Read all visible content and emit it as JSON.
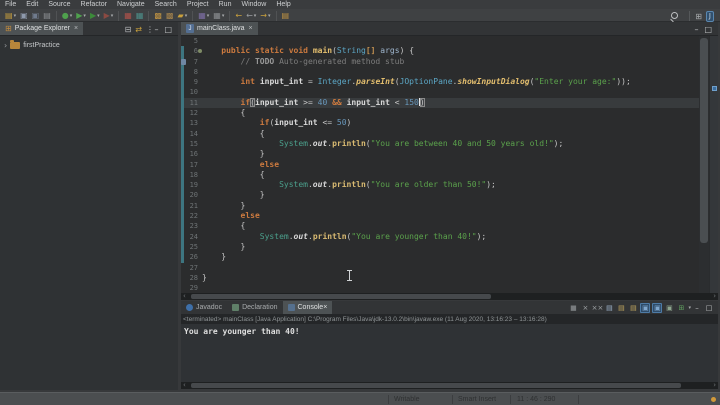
{
  "menu": {
    "items": [
      "File",
      "Edit",
      "Source",
      "Refactor",
      "Navigate",
      "Search",
      "Project",
      "Run",
      "Window",
      "Help"
    ]
  },
  "glyphs": {
    "close": "×",
    "dropdown": "▾",
    "chevron": "›",
    "minimize": "–",
    "maximize": "□",
    "collapse_all": "⊟",
    "link_editor": "⇄",
    "view_menu": "⋮",
    "scroll_left": "‹",
    "scroll_right": "›"
  },
  "toolbar": {
    "items": [
      {
        "name": "new-wizard-icon",
        "ch": "▤",
        "fg": "#C9A03C",
        "dd": true
      },
      {
        "name": "save-icon",
        "ch": "▣",
        "fg": "#8E99AC"
      },
      {
        "name": "save-all-icon",
        "ch": "▣",
        "fg": "#6F7A8C"
      },
      {
        "name": "print-icon",
        "ch": "▤",
        "fg": "#8A8D90"
      },
      {
        "sep": true
      },
      {
        "name": "debug-icon",
        "ch": "●",
        "fg": "#4FA14D",
        "dd": true
      },
      {
        "name": "run-icon",
        "ch": "▶",
        "fg": "#4FA14D",
        "dd": true
      },
      {
        "name": "run-external-icon",
        "ch": "▶",
        "fg": "#3C8B3A",
        "dd": true
      },
      {
        "name": "coverage-icon",
        "ch": "▶",
        "fg": "#8B4A42",
        "dd": true
      },
      {
        "sep": true
      },
      {
        "name": "stop-icon",
        "ch": "▦",
        "fg": "#B0524A"
      },
      {
        "name": "build-icon",
        "ch": "▦",
        "fg": "#4D8F8A"
      },
      {
        "sep": true
      },
      {
        "name": "new-java-project-icon",
        "ch": "▩",
        "fg": "#BD9142"
      },
      {
        "name": "new-package-icon",
        "ch": "▩",
        "fg": "#A5834C"
      },
      {
        "name": "new-class-icon",
        "ch": "▰",
        "fg": "#C9A03C",
        "dd": true
      },
      {
        "sep": true
      },
      {
        "name": "task-icon",
        "ch": "▦",
        "fg": "#7E6FA5",
        "dd": true
      },
      {
        "name": "annotation-icon",
        "ch": "▦",
        "fg": "#8A8D90",
        "dd": true
      },
      {
        "sep": true
      },
      {
        "name": "back-icon",
        "ch": "←",
        "fg": "#C9A03C"
      },
      {
        "name": "back-history-icon",
        "ch": "←",
        "fg": "#9A9DA0",
        "dd": true
      },
      {
        "name": "forward-icon",
        "ch": "→",
        "fg": "#C9A03C",
        "dd": true
      },
      {
        "sep": true
      },
      {
        "name": "last-edit-icon",
        "ch": "▤",
        "fg": "#BD9142"
      }
    ]
  },
  "package_explorer": {
    "tab_label": "Package Explorer",
    "project": "firstPractice",
    "tools": [
      {
        "name": "collapse-all-icon",
        "glyph": "⊟",
        "color": "#B9BCBE"
      },
      {
        "name": "link-editor-icon",
        "glyph": "⇄",
        "color": "#C9A03C"
      },
      {
        "name": "view-menu-icon",
        "glyph": "⋮",
        "color": "#B9BCBE"
      }
    ]
  },
  "editor": {
    "tab_label": "mainClass.java",
    "file_icon_letter": "J",
    "active_line": 11,
    "lines": [
      {
        "n": 5,
        "diff": false,
        "tokens": []
      },
      {
        "n": 6,
        "diff": true,
        "marker": "dot",
        "tokens": [
          [
            "ws",
            "    "
          ],
          [
            "kw",
            "public"
          ],
          [
            "plain",
            " "
          ],
          [
            "kw",
            "static"
          ],
          [
            "plain",
            " "
          ],
          [
            "kw",
            "void"
          ],
          [
            "plain",
            " "
          ],
          [
            "decl",
            "main"
          ],
          [
            "plain",
            "("
          ],
          [
            "type",
            "String"
          ],
          [
            "arr",
            "[]"
          ],
          [
            "plain",
            " "
          ],
          [
            "param",
            "args"
          ],
          [
            "plain",
            ") {"
          ]
        ]
      },
      {
        "n": 7,
        "diff": true,
        "marker": "task",
        "tokens": [
          [
            "ws",
            "        "
          ],
          [
            "cmt",
            "// "
          ],
          [
            "task",
            "TODO"
          ],
          [
            "cmt",
            " Auto-generated method stub"
          ]
        ]
      },
      {
        "n": 8,
        "diff": true,
        "tokens": []
      },
      {
        "n": 9,
        "diff": true,
        "tokens": [
          [
            "ws",
            "        "
          ],
          [
            "kw",
            "int"
          ],
          [
            "plain",
            " "
          ],
          [
            "var",
            "input_int"
          ],
          [
            "plain",
            " = "
          ],
          [
            "type",
            "Integer"
          ],
          [
            "plain",
            "."
          ],
          [
            "smeth",
            "parseInt"
          ],
          [
            "plain",
            "("
          ],
          [
            "type",
            "JOptionPane"
          ],
          [
            "plain",
            "."
          ],
          [
            "smeth",
            "showInputDialog"
          ],
          [
            "plain",
            "("
          ],
          [
            "str",
            "\"Enter your age:\""
          ],
          [
            "plain",
            "));"
          ]
        ]
      },
      {
        "n": 10,
        "diff": true,
        "tokens": []
      },
      {
        "n": 11,
        "diff": true,
        "tokens": [
          [
            "ws",
            "        "
          ],
          [
            "kw",
            "if"
          ],
          [
            "brkt",
            "("
          ],
          [
            "var",
            "input_int"
          ],
          [
            "plain",
            " >= "
          ],
          [
            "num",
            "40"
          ],
          [
            "plain",
            " "
          ],
          [
            "op2",
            "&&"
          ],
          [
            "plain",
            " "
          ],
          [
            "var",
            "input_int"
          ],
          [
            "plain",
            " < "
          ],
          [
            "num",
            "150"
          ],
          [
            "caret",
            ""
          ],
          [
            "brkt",
            ")"
          ]
        ]
      },
      {
        "n": 12,
        "diff": true,
        "tokens": [
          [
            "ws",
            "        "
          ],
          [
            "plain",
            "{"
          ]
        ]
      },
      {
        "n": 13,
        "diff": true,
        "tokens": [
          [
            "ws",
            "            "
          ],
          [
            "kw",
            "if"
          ],
          [
            "plain",
            "("
          ],
          [
            "var",
            "input_int"
          ],
          [
            "plain",
            " <= "
          ],
          [
            "num",
            "50"
          ],
          [
            "plain",
            ")"
          ]
        ]
      },
      {
        "n": 14,
        "diff": true,
        "tokens": [
          [
            "ws",
            "            "
          ],
          [
            "plain",
            "{"
          ]
        ]
      },
      {
        "n": 15,
        "diff": true,
        "tokens": [
          [
            "ws",
            "                "
          ],
          [
            "sys",
            "System"
          ],
          [
            "plain",
            "."
          ],
          [
            "field",
            "out"
          ],
          [
            "plain",
            "."
          ],
          [
            "meth",
            "println"
          ],
          [
            "plain",
            "("
          ],
          [
            "str",
            "\"You are between 40 and 50 years old!\""
          ],
          [
            "plain",
            ");"
          ]
        ]
      },
      {
        "n": 16,
        "diff": true,
        "tokens": [
          [
            "ws",
            "            "
          ],
          [
            "plain",
            "}"
          ]
        ]
      },
      {
        "n": 17,
        "diff": true,
        "tokens": [
          [
            "ws",
            "            "
          ],
          [
            "kw",
            "else"
          ]
        ]
      },
      {
        "n": 18,
        "diff": true,
        "tokens": [
          [
            "ws",
            "            "
          ],
          [
            "plain",
            "{"
          ]
        ]
      },
      {
        "n": 19,
        "diff": true,
        "tokens": [
          [
            "ws",
            "                "
          ],
          [
            "sys",
            "System"
          ],
          [
            "plain",
            "."
          ],
          [
            "field",
            "out"
          ],
          [
            "plain",
            "."
          ],
          [
            "meth",
            "println"
          ],
          [
            "plain",
            "("
          ],
          [
            "str",
            "\"You are older than 50!\""
          ],
          [
            "plain",
            ");"
          ]
        ]
      },
      {
        "n": 20,
        "diff": true,
        "tokens": [
          [
            "ws",
            "            "
          ],
          [
            "plain",
            "}"
          ]
        ]
      },
      {
        "n": 21,
        "diff": true,
        "tokens": [
          [
            "ws",
            "        "
          ],
          [
            "plain",
            "}"
          ]
        ]
      },
      {
        "n": 22,
        "diff": true,
        "tokens": [
          [
            "ws",
            "        "
          ],
          [
            "kw",
            "else"
          ]
        ]
      },
      {
        "n": 23,
        "diff": true,
        "tokens": [
          [
            "ws",
            "        "
          ],
          [
            "plain",
            "{"
          ]
        ]
      },
      {
        "n": 24,
        "diff": true,
        "tokens": [
          [
            "ws",
            "            "
          ],
          [
            "sys",
            "System"
          ],
          [
            "plain",
            "."
          ],
          [
            "field",
            "out"
          ],
          [
            "plain",
            "."
          ],
          [
            "meth",
            "println"
          ],
          [
            "plain",
            "("
          ],
          [
            "str",
            "\"You are younger than 40!\""
          ],
          [
            "plain",
            ");"
          ]
        ]
      },
      {
        "n": 25,
        "diff": true,
        "tokens": [
          [
            "ws",
            "        "
          ],
          [
            "plain",
            "}"
          ]
        ]
      },
      {
        "n": 26,
        "diff": true,
        "tokens": [
          [
            "ws",
            "    "
          ],
          [
            "plain",
            "}"
          ]
        ]
      },
      {
        "n": 27,
        "diff": false,
        "tokens": []
      },
      {
        "n": 28,
        "diff": false,
        "tokens": [
          [
            "plain",
            "}"
          ]
        ]
      },
      {
        "n": 29,
        "diff": false,
        "tokens": []
      }
    ]
  },
  "console": {
    "tabs": [
      {
        "label": "Javadoc"
      },
      {
        "label": "Declaration"
      },
      {
        "label": "Console",
        "active": true
      }
    ],
    "toolbar": [
      {
        "name": "terminate-icon",
        "ch": "■",
        "fg": "#787B7E"
      },
      {
        "name": "remove-launch-icon",
        "ch": "×",
        "fg": "#9FA3A6"
      },
      {
        "name": "remove-all-launches-icon",
        "ch": "××",
        "fg": "#9FA3A6"
      },
      {
        "name": "clear-console-icon",
        "ch": "▤",
        "fg": "#9FB6CE"
      },
      {
        "name": "scroll-lock-icon",
        "ch": "▤",
        "fg": "#C4A95E"
      },
      {
        "name": "word-wrap-icon",
        "ch": "▤",
        "fg": "#C4A95E"
      },
      {
        "name": "pin-console-icon",
        "ch": "▣",
        "fg": "#7FA6CC",
        "hl": true
      },
      {
        "name": "show-stdout-icon",
        "ch": "▣",
        "fg": "#7FA6CC",
        "hl": true
      },
      {
        "name": "show-stderr-icon",
        "ch": "▣",
        "fg": "#8FA68F"
      },
      {
        "name": "open-console-icon",
        "ch": "⊞",
        "fg": "#5FA05F",
        "dd": true
      },
      {
        "name": "minimize-icon",
        "ch": "–",
        "fg": "#C2C5C7"
      },
      {
        "name": "maximize-icon",
        "ch": "□",
        "fg": "#C2C5C7"
      }
    ],
    "status": "<terminated> mainClass [Java Application] C:\\Program Files\\Java\\jdk-13.0.2\\bin\\javaw.exe (11 Aug 2020, 13:16:23 – 13:16:28)",
    "output": "You are younger than 40!"
  },
  "status_bar": {
    "writable": "Writable",
    "input_mode": "Smart Insert",
    "caret_position": "11 : 46 : 290"
  },
  "colors": {
    "diff_teal": "#3D7580",
    "keyword_orange": "#CC7A3F",
    "string_green": "#5BA24C",
    "number_blue": "#6897BB",
    "marker_blue": "#3C6E9F",
    "notification_amber": "#D29A3A"
  }
}
